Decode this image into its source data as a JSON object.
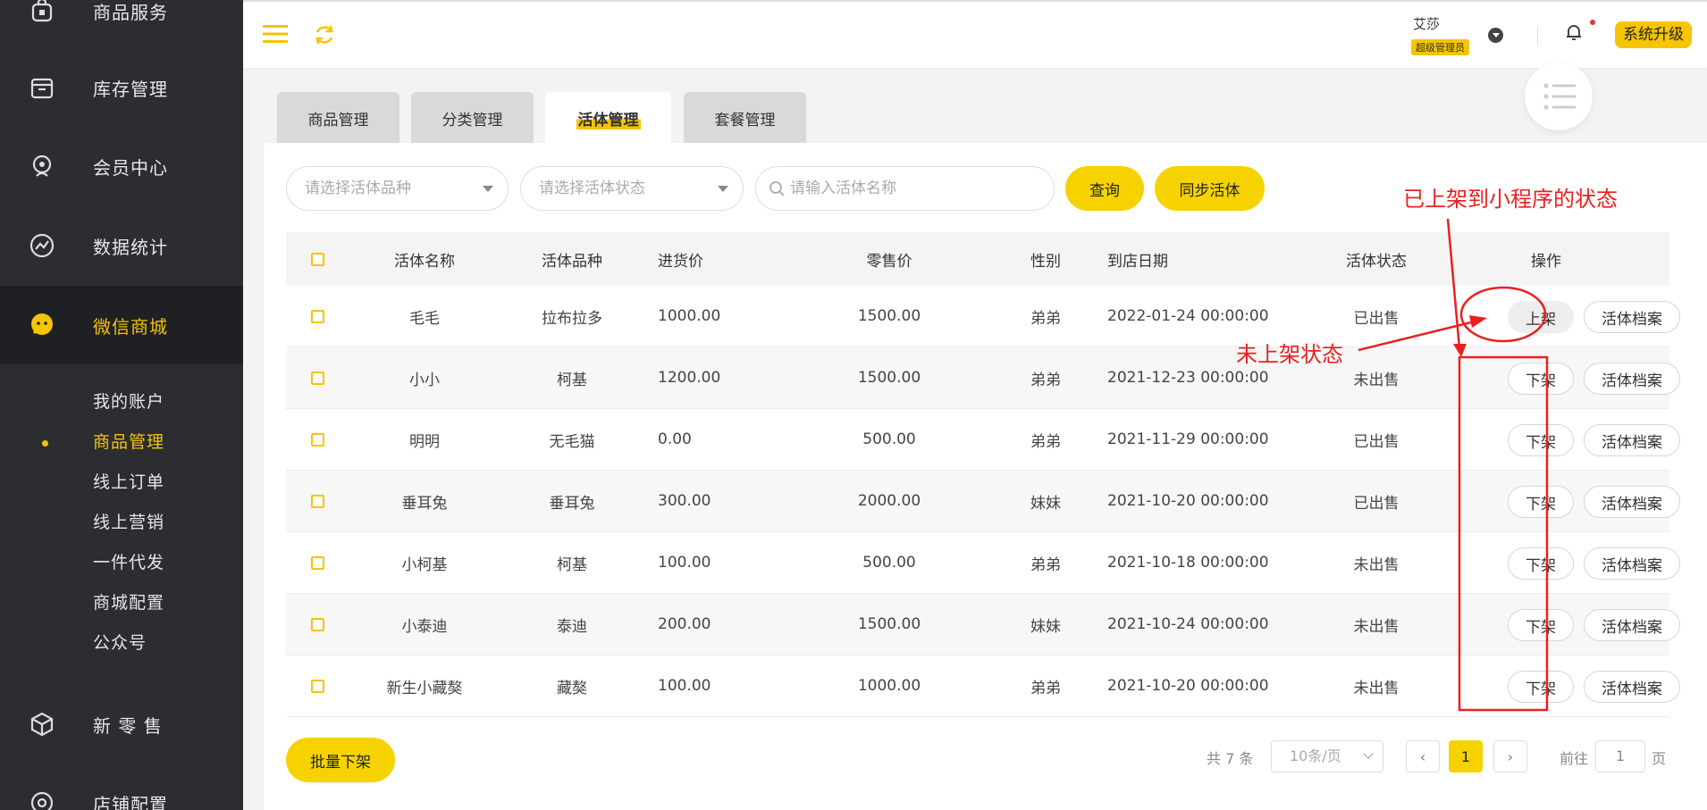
{
  "sidebar": {
    "items": [
      {
        "label": "商品服务",
        "icon": "bag-icon"
      },
      {
        "label": "库存管理",
        "icon": "box-icon"
      },
      {
        "label": "会员中心",
        "icon": "member-icon"
      },
      {
        "label": "数据统计",
        "icon": "chart-icon"
      },
      {
        "label": "微信商城",
        "icon": "wechat-icon"
      },
      {
        "label": "新 零 售",
        "icon": "cube-icon"
      },
      {
        "label": "店铺配置",
        "icon": "store-icon"
      }
    ],
    "sub_items": [
      {
        "label": "我的账户"
      },
      {
        "label": "商品管理"
      },
      {
        "label": "线上订单"
      },
      {
        "label": "线上营销"
      },
      {
        "label": "一件代发"
      },
      {
        "label": "商城配置"
      },
      {
        "label": "公众号"
      }
    ]
  },
  "header": {
    "user_name": "艾莎",
    "user_role": "超级管理员",
    "upgrade_label": "系统升级"
  },
  "tabs": [
    {
      "label": "商品管理"
    },
    {
      "label": "分类管理"
    },
    {
      "label": "活体管理"
    },
    {
      "label": "套餐管理"
    }
  ],
  "filters": {
    "breed_placeholder": "请选择活体品种",
    "status_placeholder": "请选择活体状态",
    "name_placeholder": "请输入活体名称",
    "query_label": "查询",
    "sync_label": "同步活体"
  },
  "table": {
    "columns": [
      "活体名称",
      "活体品种",
      "进货价",
      "零售价",
      "性别",
      "到店日期",
      "活体状态",
      "操作"
    ],
    "rows": [
      {
        "name": "毛毛",
        "breed": "拉布拉多",
        "cost": "1000.00",
        "price": "1500.00",
        "gender": "弟弟",
        "date": "2022-01-24 00:00:00",
        "status": "已出售",
        "shelf": "上架",
        "archive": "活体档案"
      },
      {
        "name": "小小",
        "breed": "柯基",
        "cost": "1200.00",
        "price": "1500.00",
        "gender": "弟弟",
        "date": "2021-12-23 00:00:00",
        "status": "未出售",
        "shelf": "下架",
        "archive": "活体档案"
      },
      {
        "name": "明明",
        "breed": "无毛猫",
        "cost": "0.00",
        "price": "500.00",
        "gender": "弟弟",
        "date": "2021-11-29 00:00:00",
        "status": "已出售",
        "shelf": "下架",
        "archive": "活体档案"
      },
      {
        "name": "垂耳兔",
        "breed": "垂耳兔",
        "cost": "300.00",
        "price": "2000.00",
        "gender": "妹妹",
        "date": "2021-10-20 00:00:00",
        "status": "已出售",
        "shelf": "下架",
        "archive": "活体档案"
      },
      {
        "name": "小柯基",
        "breed": "柯基",
        "cost": "100.00",
        "price": "500.00",
        "gender": "弟弟",
        "date": "2021-10-18 00:00:00",
        "status": "未出售",
        "shelf": "下架",
        "archive": "活体档案"
      },
      {
        "name": "小泰迪",
        "breed": "泰迪",
        "cost": "200.00",
        "price": "1500.00",
        "gender": "妹妹",
        "date": "2021-10-24 00:00:00",
        "status": "未出售",
        "shelf": "下架",
        "archive": "活体档案"
      },
      {
        "name": "新生小藏獒",
        "breed": "藏獒",
        "cost": "100.00",
        "price": "1000.00",
        "gender": "弟弟",
        "date": "2021-10-20 00:00:00",
        "status": "未出售",
        "shelf": "下架",
        "archive": "活体档案"
      }
    ]
  },
  "footer": {
    "batch_label": "批量下架",
    "total": "共 7 条",
    "page_size": "10条/页",
    "current_page": "1",
    "goto_prefix": "前往",
    "goto_value": "1",
    "goto_suffix": "页"
  },
  "annotations": {
    "listed_note": "已上架到小程序的状态",
    "unlisted_note": "未上架状态"
  },
  "colors": {
    "accent": "#f6c400",
    "sidebar_bg": "#2b2d31",
    "annotation": "#ea2020"
  }
}
